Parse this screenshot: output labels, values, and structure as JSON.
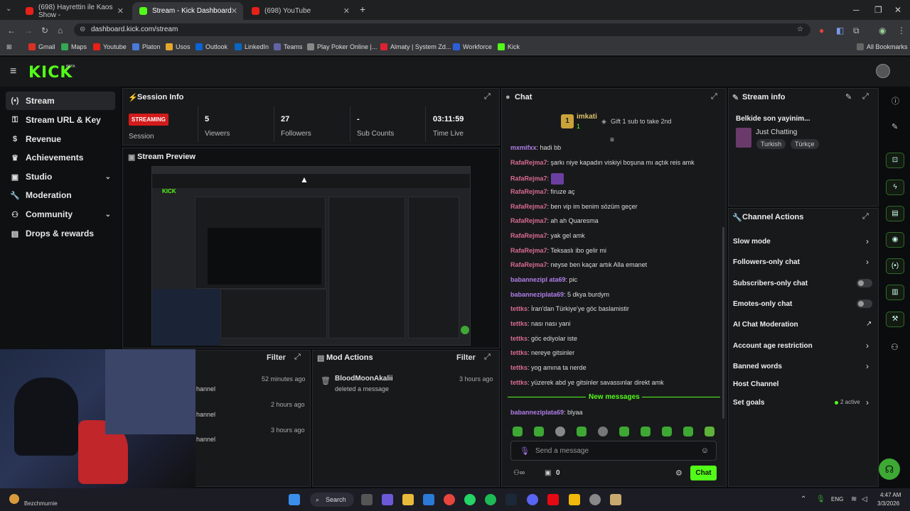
{
  "browser": {
    "tabs": [
      {
        "label": "(698) Hayrettin ile Kaos Show -"
      },
      {
        "label": "Stream - Kick Dashboard"
      },
      {
        "label": "(698) YouTube"
      }
    ],
    "url": "dashboard.kick.com/stream",
    "bookmarks": [
      "Gmail",
      "Maps",
      "Youtube",
      "Platon",
      "Usos",
      "Outlook",
      "LinkedIn",
      "Teams",
      "Play Poker Online |...",
      "Almaty | System Zd...",
      "Workforce",
      "Kick"
    ],
    "all_bookmarks": "All Bookmarks"
  },
  "brand": {
    "logo": "KICK",
    "beta": "BETA",
    "accent": "#53fc18"
  },
  "sidebar": {
    "items": [
      {
        "label": "Stream",
        "icon": "broadcast-icon"
      },
      {
        "label": "Stream URL & Key",
        "icon": "key-icon"
      },
      {
        "label": "Revenue",
        "icon": "dollar-icon"
      },
      {
        "label": "Achievements",
        "icon": "trophy-icon"
      },
      {
        "label": "Studio",
        "icon": "studio-icon"
      },
      {
        "label": "Moderation",
        "icon": "wrench-icon"
      },
      {
        "label": "Community",
        "icon": "people-icon"
      },
      {
        "label": "Drops & rewards",
        "icon": "gift-icon"
      }
    ]
  },
  "session": {
    "title": "Session Info",
    "badge": "STREAMING",
    "badge_label": "Session",
    "stats": [
      {
        "value": "5",
        "label": "Viewers"
      },
      {
        "value": "27",
        "label": "Followers"
      },
      {
        "value": "-",
        "label": "Sub Counts"
      },
      {
        "value": "03:11:59",
        "label": "Time Live"
      }
    ]
  },
  "preview": {
    "title": "Stream Preview"
  },
  "activity": {
    "filter": "Filter",
    "items": [
      {
        "time": "52 minutes ago",
        "text": "hannel"
      },
      {
        "time": "2 hours ago",
        "text": "hannel"
      },
      {
        "time": "3 hours ago",
        "text": "hannel"
      }
    ]
  },
  "mod_actions": {
    "title": "Mod Actions",
    "filter": "Filter",
    "items": [
      {
        "user": "BloodMoonAkalii",
        "action": "deleted a message",
        "time": "3 hours ago"
      }
    ]
  },
  "chat": {
    "title": "Chat",
    "pinned_user": "imkati",
    "pinned_count": "1",
    "gift_text": "Gift 1 sub to take 2nd",
    "messages": [
      {
        "user": "mxmifxx",
        "text": "hadi bb",
        "color": "#b07ee8"
      },
      {
        "user": "RafaRejma7",
        "text": "şarkı niye kapadın viskiyi boşuna mı açtık reis amk",
        "color": "#d76b8f"
      },
      {
        "user": "RafaRejma7",
        "text": "",
        "color": "#d76b8f"
      },
      {
        "user": "RafaRejma7",
        "text": "firuze aç",
        "color": "#d76b8f"
      },
      {
        "user": "RafaRejma7",
        "text": "ben vip im benim sözüm geçer",
        "color": "#d76b8f"
      },
      {
        "user": "RafaRejma7",
        "text": "ah ah Quaresma",
        "color": "#d76b8f"
      },
      {
        "user": "RafaRejma7",
        "text": "yak gel amk",
        "color": "#d76b8f"
      },
      {
        "user": "RafaRejma7",
        "text": "Teksaslı ibo gelir mi",
        "color": "#d76b8f"
      },
      {
        "user": "RafaRejma7",
        "text": "neyse ben kaçar artık Alla emanet",
        "color": "#d76b8f"
      },
      {
        "user": "babannezipl ata69",
        "text": "pic",
        "color": "#b07ee8"
      },
      {
        "user": "babanneziplata69",
        "text": "5 dkya burdym",
        "color": "#b07ee8"
      },
      {
        "user": "tettks",
        "text": "İran'dan Türkiye'ye göc baslamistir",
        "color": "#d76b8f"
      },
      {
        "user": "tettks",
        "text": "nası nası yani",
        "color": "#d76b8f"
      },
      {
        "user": "tettks",
        "text": "göc ediyolar iste",
        "color": "#d76b8f"
      },
      {
        "user": "tettks",
        "text": "nereye gitsinler",
        "color": "#d76b8f"
      },
      {
        "user": "tettks",
        "text": "yog amına ta nerde",
        "color": "#d76b8f"
      },
      {
        "user": "tettks",
        "text": "yüzerek abd ye gitsinler savassınlar direkt amk",
        "color": "#d76b8f"
      }
    ],
    "new_messages": "New messages",
    "after_new": {
      "user": "babanneziplata69",
      "text": "blyaa",
      "color": "#b07ee8"
    },
    "input_placeholder": "Send a message",
    "count": "0",
    "send_label": "Chat"
  },
  "stream_info": {
    "title": "Stream info",
    "stream_title": "Belkide son yayinim...",
    "category": "Just Chatting",
    "tags": [
      "Turkish",
      "Türkçe"
    ]
  },
  "channel_actions": {
    "title": "Channel Actions",
    "items": [
      {
        "label": "Slow mode",
        "control": "chevron"
      },
      {
        "label": "Followers-only chat",
        "control": "chevron"
      },
      {
        "label": "Subscribers-only chat",
        "control": "toggle"
      },
      {
        "label": "Emotes-only chat",
        "control": "toggle"
      },
      {
        "label": "AI Chat Moderation",
        "control": "external"
      },
      {
        "label": "Account age restriction",
        "control": "chevron"
      },
      {
        "label": "Banned words",
        "control": "chevron"
      },
      {
        "label": "Host Channel",
        "control": "none"
      },
      {
        "label": "Set goals",
        "control": "chevron"
      }
    ],
    "goals_status": "2 active"
  },
  "webcam": {
    "caption": "Bezchmurnie"
  },
  "taskbar": {
    "search": "Search",
    "lang": "ENG",
    "time": "4:47 AM",
    "date": "3/3/2026"
  }
}
